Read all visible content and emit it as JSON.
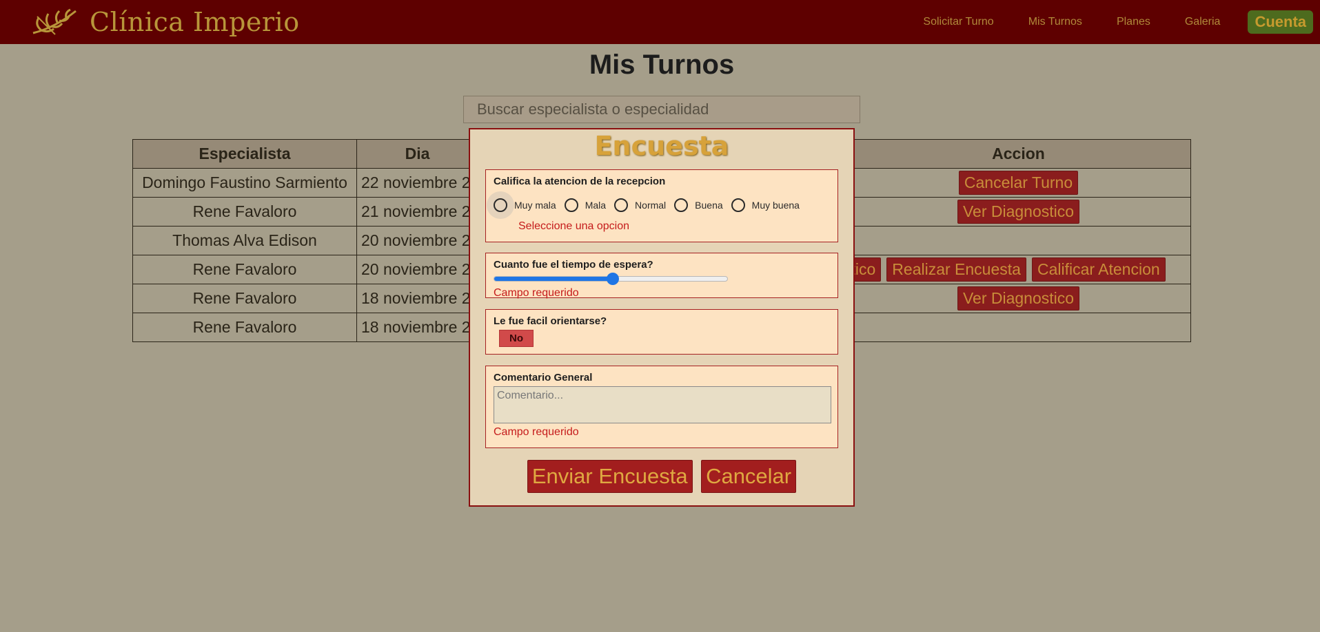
{
  "navbar": {
    "brand": "Clínica Imperio",
    "links": [
      "Solicitar Turno",
      "Mis Turnos",
      "Planes",
      "Galeria"
    ],
    "account": "Cuenta",
    "colors": {
      "background": "#5e0000",
      "accent": "#b8963a",
      "account_bg": "#4d6b1e"
    }
  },
  "page": {
    "title": "Mis Turnos",
    "search_placeholder": "Buscar especialista o especialidad"
  },
  "table": {
    "headers": {
      "especialista": "Especialista",
      "dia": "Dia",
      "accion": "Accion"
    },
    "rows": [
      {
        "especialista": "Domingo Faustino Sarmiento",
        "dia": "22 noviembre 2",
        "actions": [
          "Cancelar Turno"
        ]
      },
      {
        "especialista": "Rene Favaloro",
        "dia": "21 noviembre 2",
        "actions": [
          "Ver Diagnostico"
        ]
      },
      {
        "especialista": "Thomas Alva Edison",
        "dia": "20 noviembre 2",
        "actions": []
      },
      {
        "especialista": "Rene Favaloro",
        "dia": "20 noviembre 2",
        "actions": [
          "stico",
          "Realizar Encuesta",
          "Calificar Atencion"
        ]
      },
      {
        "especialista": "Rene Favaloro",
        "dia": "18 noviembre 2",
        "actions": [
          "Ver Diagnostico"
        ]
      },
      {
        "especialista": "Rene Favaloro",
        "dia": "18 noviembre 2",
        "actions": []
      }
    ]
  },
  "modal": {
    "title": "Encuesta",
    "q1": {
      "label": "Califica la atencion de la recepcion",
      "options": [
        "Muy mala",
        "Mala",
        "Normal",
        "Buena",
        "Muy buena"
      ],
      "error": "Seleccione una opcion"
    },
    "q2": {
      "label": "Cuanto fue el tiempo de espera?",
      "slider_value": 0.51,
      "error": "Campo requerido"
    },
    "q3": {
      "label": "Le fue facil orientarse?",
      "toggle": "No"
    },
    "q4": {
      "label": "Comentario General",
      "placeholder": "Comentario...",
      "error": "Campo requerido"
    },
    "submit": "Enviar Encuesta",
    "cancel": "Cancelar"
  }
}
